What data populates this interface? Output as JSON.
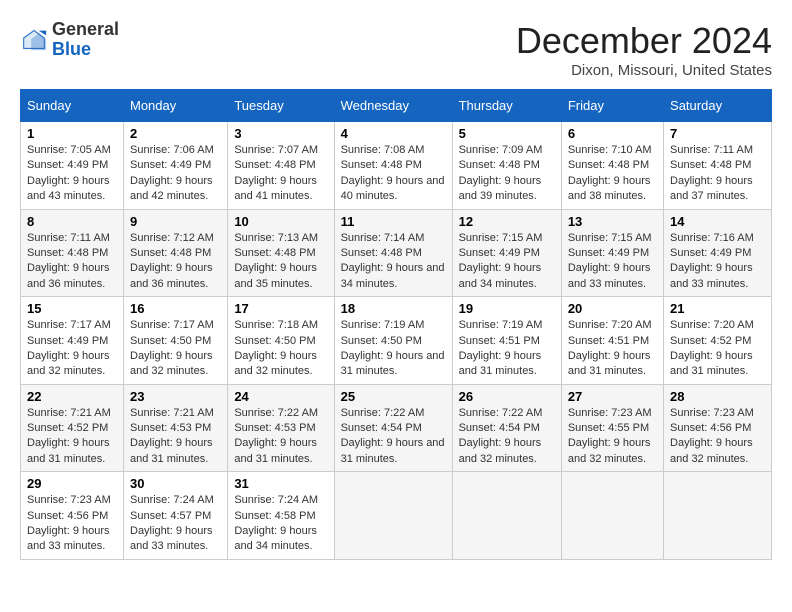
{
  "header": {
    "logo": {
      "line1": "General",
      "line2": "Blue"
    },
    "title": "December 2024",
    "location": "Dixon, Missouri, United States"
  },
  "days_of_week": [
    "Sunday",
    "Monday",
    "Tuesday",
    "Wednesday",
    "Thursday",
    "Friday",
    "Saturday"
  ],
  "weeks": [
    [
      {
        "day": "1",
        "sunrise": "7:05 AM",
        "sunset": "4:49 PM",
        "daylight": "9 hours and 43 minutes."
      },
      {
        "day": "2",
        "sunrise": "7:06 AM",
        "sunset": "4:49 PM",
        "daylight": "9 hours and 42 minutes."
      },
      {
        "day": "3",
        "sunrise": "7:07 AM",
        "sunset": "4:48 PM",
        "daylight": "9 hours and 41 minutes."
      },
      {
        "day": "4",
        "sunrise": "7:08 AM",
        "sunset": "4:48 PM",
        "daylight": "9 hours and 40 minutes."
      },
      {
        "day": "5",
        "sunrise": "7:09 AM",
        "sunset": "4:48 PM",
        "daylight": "9 hours and 39 minutes."
      },
      {
        "day": "6",
        "sunrise": "7:10 AM",
        "sunset": "4:48 PM",
        "daylight": "9 hours and 38 minutes."
      },
      {
        "day": "7",
        "sunrise": "7:11 AM",
        "sunset": "4:48 PM",
        "daylight": "9 hours and 37 minutes."
      }
    ],
    [
      {
        "day": "8",
        "sunrise": "7:11 AM",
        "sunset": "4:48 PM",
        "daylight": "9 hours and 36 minutes."
      },
      {
        "day": "9",
        "sunrise": "7:12 AM",
        "sunset": "4:48 PM",
        "daylight": "9 hours and 36 minutes."
      },
      {
        "day": "10",
        "sunrise": "7:13 AM",
        "sunset": "4:48 PM",
        "daylight": "9 hours and 35 minutes."
      },
      {
        "day": "11",
        "sunrise": "7:14 AM",
        "sunset": "4:48 PM",
        "daylight": "9 hours and 34 minutes."
      },
      {
        "day": "12",
        "sunrise": "7:15 AM",
        "sunset": "4:49 PM",
        "daylight": "9 hours and 34 minutes."
      },
      {
        "day": "13",
        "sunrise": "7:15 AM",
        "sunset": "4:49 PM",
        "daylight": "9 hours and 33 minutes."
      },
      {
        "day": "14",
        "sunrise": "7:16 AM",
        "sunset": "4:49 PM",
        "daylight": "9 hours and 33 minutes."
      }
    ],
    [
      {
        "day": "15",
        "sunrise": "7:17 AM",
        "sunset": "4:49 PM",
        "daylight": "9 hours and 32 minutes."
      },
      {
        "day": "16",
        "sunrise": "7:17 AM",
        "sunset": "4:50 PM",
        "daylight": "9 hours and 32 minutes."
      },
      {
        "day": "17",
        "sunrise": "7:18 AM",
        "sunset": "4:50 PM",
        "daylight": "9 hours and 32 minutes."
      },
      {
        "day": "18",
        "sunrise": "7:19 AM",
        "sunset": "4:50 PM",
        "daylight": "9 hours and 31 minutes."
      },
      {
        "day": "19",
        "sunrise": "7:19 AM",
        "sunset": "4:51 PM",
        "daylight": "9 hours and 31 minutes."
      },
      {
        "day": "20",
        "sunrise": "7:20 AM",
        "sunset": "4:51 PM",
        "daylight": "9 hours and 31 minutes."
      },
      {
        "day": "21",
        "sunrise": "7:20 AM",
        "sunset": "4:52 PM",
        "daylight": "9 hours and 31 minutes."
      }
    ],
    [
      {
        "day": "22",
        "sunrise": "7:21 AM",
        "sunset": "4:52 PM",
        "daylight": "9 hours and 31 minutes."
      },
      {
        "day": "23",
        "sunrise": "7:21 AM",
        "sunset": "4:53 PM",
        "daylight": "9 hours and 31 minutes."
      },
      {
        "day": "24",
        "sunrise": "7:22 AM",
        "sunset": "4:53 PM",
        "daylight": "9 hours and 31 minutes."
      },
      {
        "day": "25",
        "sunrise": "7:22 AM",
        "sunset": "4:54 PM",
        "daylight": "9 hours and 31 minutes."
      },
      {
        "day": "26",
        "sunrise": "7:22 AM",
        "sunset": "4:54 PM",
        "daylight": "9 hours and 32 minutes."
      },
      {
        "day": "27",
        "sunrise": "7:23 AM",
        "sunset": "4:55 PM",
        "daylight": "9 hours and 32 minutes."
      },
      {
        "day": "28",
        "sunrise": "7:23 AM",
        "sunset": "4:56 PM",
        "daylight": "9 hours and 32 minutes."
      }
    ],
    [
      {
        "day": "29",
        "sunrise": "7:23 AM",
        "sunset": "4:56 PM",
        "daylight": "9 hours and 33 minutes."
      },
      {
        "day": "30",
        "sunrise": "7:24 AM",
        "sunset": "4:57 PM",
        "daylight": "9 hours and 33 minutes."
      },
      {
        "day": "31",
        "sunrise": "7:24 AM",
        "sunset": "4:58 PM",
        "daylight": "9 hours and 34 minutes."
      },
      null,
      null,
      null,
      null
    ]
  ],
  "labels": {
    "sunrise": "Sunrise:",
    "sunset": "Sunset:",
    "daylight": "Daylight:"
  }
}
